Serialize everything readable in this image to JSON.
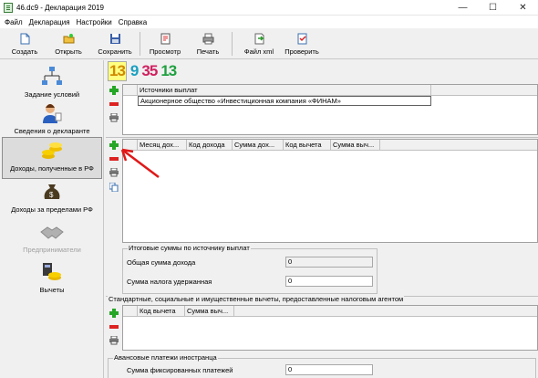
{
  "window": {
    "title": "46.dc9 - Декларация 2019",
    "minimize": "—",
    "maximize": "☐",
    "close": "✕"
  },
  "menu": [
    "Файл",
    "Декларация",
    "Настройки",
    "Справка"
  ],
  "toolbar": {
    "create": "Создать",
    "open": "Открыть",
    "save": "Сохранить",
    "preview": "Просмотр",
    "print": "Печать",
    "xml": "Файл xml",
    "check": "Проверить"
  },
  "nav": {
    "conditions": "Задание условий",
    "declarant": "Сведения о декларанте",
    "income_rf": "Доходы, полученные в РФ",
    "income_abroad": "Доходы за пределами РФ",
    "entrepreneurs": "Предприниматели",
    "deductions": "Вычеты"
  },
  "numbers": [
    "13",
    "9",
    "35",
    "13"
  ],
  "sources": {
    "header": "Источники выплат",
    "rows": [
      "Акционерное общество «Инвестиционная компания «ФИНАМ»"
    ]
  },
  "income_table": {
    "columns": [
      "Месяц дох...",
      "Код дохода",
      "Сумма дох...",
      "Код вычета",
      "Сумма выч..."
    ]
  },
  "totals": {
    "title": "Итоговые суммы по источнику выплат",
    "income_label": "Общая сумма дохода",
    "income_value": "0",
    "tax_label": "Сумма налога удержанная",
    "tax_value": "0"
  },
  "std_deductions": {
    "title": "Стандартные, социальные и имущественные вычеты, предоставленные налоговым агентом",
    "columns": [
      "Код вычета",
      "Сумма выч..."
    ]
  },
  "advance": {
    "title": "Авансовые платежи иностранца",
    "label": "Сумма фиксированных платежей",
    "value": "0"
  },
  "colors": {
    "accent_red": "#e01818",
    "plus_green": "#26a626",
    "highlight_yellow": "#ffff80"
  }
}
